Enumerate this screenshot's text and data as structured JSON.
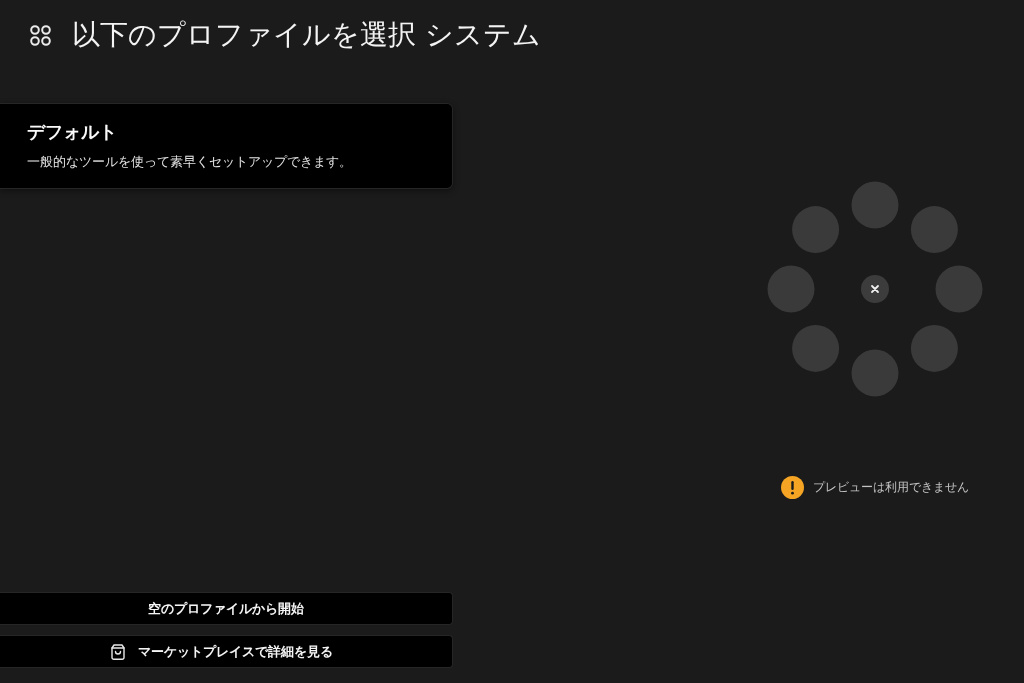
{
  "header": {
    "title": "以下のプロファイルを選択 システム"
  },
  "profiles": [
    {
      "title": "デフォルト",
      "description": "一般的なツールを使って素早くセットアップできます。"
    }
  ],
  "actions": [
    {
      "kind": "plain",
      "label": "空のプロファイルから開始"
    },
    {
      "kind": "marketplace",
      "label": "マーケットプレイスで詳細を見る"
    }
  ],
  "preview": {
    "message": "プレビューは利用できません"
  }
}
